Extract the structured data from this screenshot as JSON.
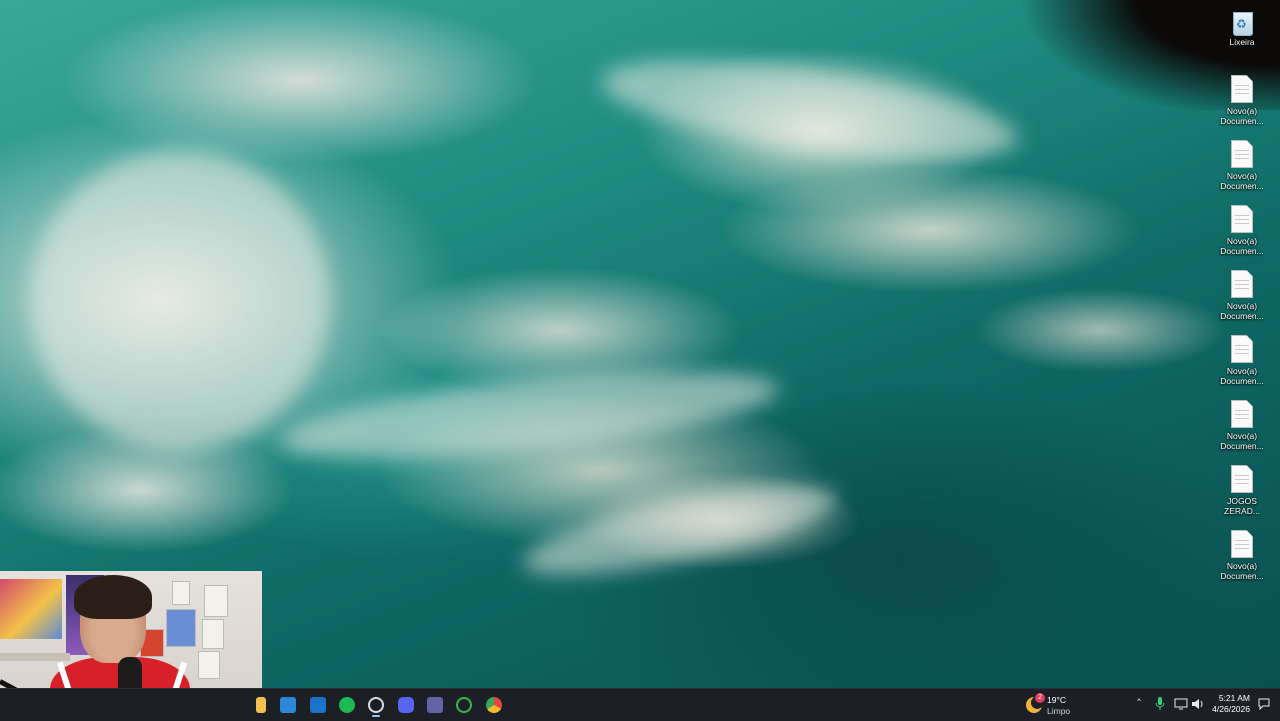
{
  "desktop": {
    "icons": [
      {
        "label": "Lixeira",
        "icon": "recycle-bin-icon"
      },
      {
        "label": "Novo(a)\nDocumen...",
        "icon": "text-document-icon"
      },
      {
        "label": "Novo(a)\nDocumen...",
        "icon": "text-document-icon"
      },
      {
        "label": "Novo(a)\nDocumen...",
        "icon": "text-document-icon"
      },
      {
        "label": "Novo(a)\nDocumen...",
        "icon": "text-document-icon"
      },
      {
        "label": "Novo(a)\nDocumen...",
        "icon": "text-document-icon"
      },
      {
        "label": "Novo(a)\nDocumen...",
        "icon": "text-document-icon"
      },
      {
        "label": "JOGOS\nZERAD...",
        "icon": "text-document-icon"
      },
      {
        "label": "Novo(a)\nDocumen...",
        "icon": "text-document-icon"
      }
    ]
  },
  "taskbar": {
    "apps": [
      {
        "name": "file-explorer",
        "color": "#f2c14e"
      },
      {
        "name": "microsoft-store",
        "color": "#2b88d8"
      },
      {
        "name": "outlook",
        "color": "#1a73c8"
      },
      {
        "name": "spotify",
        "color": "#1db954"
      },
      {
        "name": "obs-studio",
        "color": "#3a3f46"
      },
      {
        "name": "discord",
        "color": "#5865f2"
      },
      {
        "name": "teams",
        "color": "#6264a7"
      },
      {
        "name": "xbox",
        "color": "#2b7a2b"
      },
      {
        "name": "chrome",
        "color": "#e8453c"
      }
    ],
    "weather": {
      "temp": "19°C",
      "condition": "Limpo",
      "badge": "2"
    },
    "tray": {
      "chevron": "˄",
      "mic": "🎤",
      "network": "▣",
      "volume": "🔊",
      "notification": "💬"
    },
    "clock": {
      "time": "5:21 AM",
      "date": "4/26/2026"
    }
  },
  "colors": {
    "taskbar_bg": "#1c2026",
    "accent": "#8fc7ff"
  }
}
